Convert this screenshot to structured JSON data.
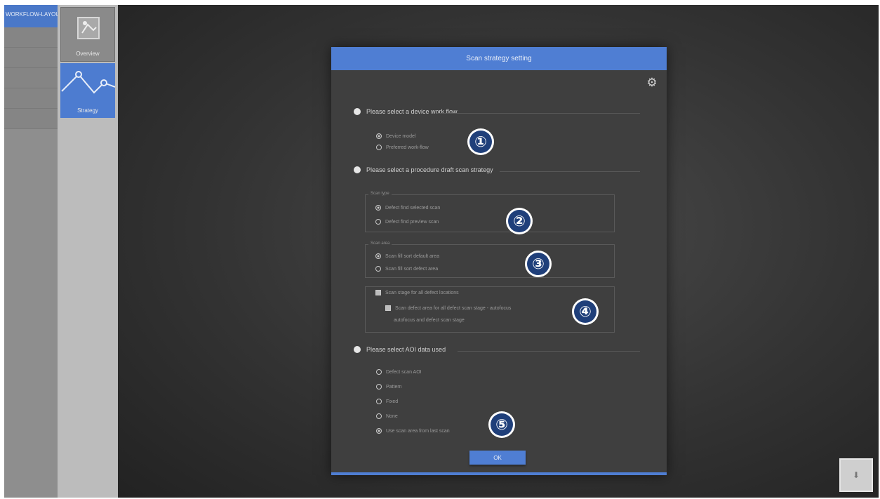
{
  "left_nav": {
    "top_tab_label": "WORKFLOW-LAYOUT",
    "items": [
      "",
      "",
      "",
      "",
      "",
      ""
    ]
  },
  "thumbnails": {
    "overview_label": "Overview",
    "strategy_label": "Strategy"
  },
  "dialog": {
    "title": "Scan strategy setting",
    "gear_icon": "gear-icon",
    "section1": {
      "label": "Please select a device work flow",
      "options": [
        {
          "label": "Device model",
          "checked": true
        },
        {
          "label": "Preferred work-flow",
          "checked": false
        }
      ]
    },
    "section2": {
      "label": "Please select a procedure draft scan strategy",
      "group_a": {
        "title": "Scan type",
        "options": [
          {
            "label": "Defect find selected scan",
            "checked": true
          },
          {
            "label": "Defect find preview scan",
            "checked": false
          }
        ]
      },
      "group_b": {
        "title": "Scan area",
        "options": [
          {
            "label": "Scan fill sort default area",
            "checked": true
          },
          {
            "label": "Scan fill sort defect area",
            "checked": false
          }
        ]
      },
      "group_c": {
        "checkbox_label": "Scan stage for all defect locations",
        "sub_checkbox_label": "Scan defect area for all defect scan stage - autofocus",
        "sub_note": "autofocus and defect scan stage"
      }
    },
    "section3": {
      "label": "Please select AOI data used",
      "options": [
        {
          "label": "Defect scan AOI",
          "checked": false
        },
        {
          "label": "Pattern",
          "checked": false
        },
        {
          "label": "Fixed",
          "checked": false
        },
        {
          "label": "None",
          "checked": false
        },
        {
          "label": "Use scan area from last scan",
          "checked": true
        }
      ]
    },
    "ok_label": "OK"
  },
  "badges": [
    "①",
    "②",
    "③",
    "④",
    "⑤"
  ],
  "corner_button_icon": "download-icon",
  "colors": {
    "accent": "#4f7ed3",
    "badge": "#1f3f7a",
    "background": "#2e2e2e"
  }
}
